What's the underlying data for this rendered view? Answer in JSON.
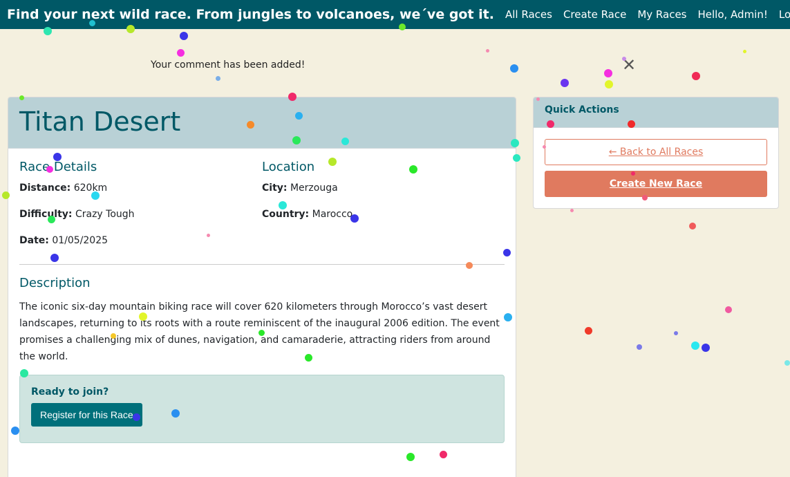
{
  "navbar": {
    "brand": "Find your next wild race. From jungles to volcanoes, we´ve got it.",
    "links": [
      "All Races",
      "Create Race",
      "My Races",
      "Hello, Admin!",
      "Logout"
    ]
  },
  "flash": {
    "message": "Your comment has been added!",
    "close_glyph": "✕"
  },
  "race": {
    "title": "Titan Desert",
    "details_heading": "Race Details",
    "location_heading": "Location",
    "distance_label": "Distance:",
    "distance_value": "620km",
    "difficulty_label": "Difficulty:",
    "difficulty_value": "Crazy Tough",
    "date_label": "Date:",
    "date_value": "01/05/2025",
    "city_label": "City:",
    "city_value": "Merzouga",
    "country_label": "Country:",
    "country_value": "Marocco",
    "description_heading": "Description",
    "description": "The iconic six-day mountain biking race will cover 620 kilometers through Morocco’s vast desert landscapes, returning to its roots with a route reminiscent of the inaugural 2006 edition. The event promises a challenging mix of dunes, navigation, and camaraderie, attracting riders from around the world.",
    "join_question": "Ready to join?",
    "register_label": "Register for this Race"
  },
  "sidebar": {
    "title": "Quick Actions",
    "back_label": "← Back to All Races",
    "create_label": "Create New Race"
  },
  "colors": {
    "navbar": "#005866",
    "accent": "#e07a5f",
    "background": "#f4f0df",
    "header_bg": "#b9d1d6"
  }
}
